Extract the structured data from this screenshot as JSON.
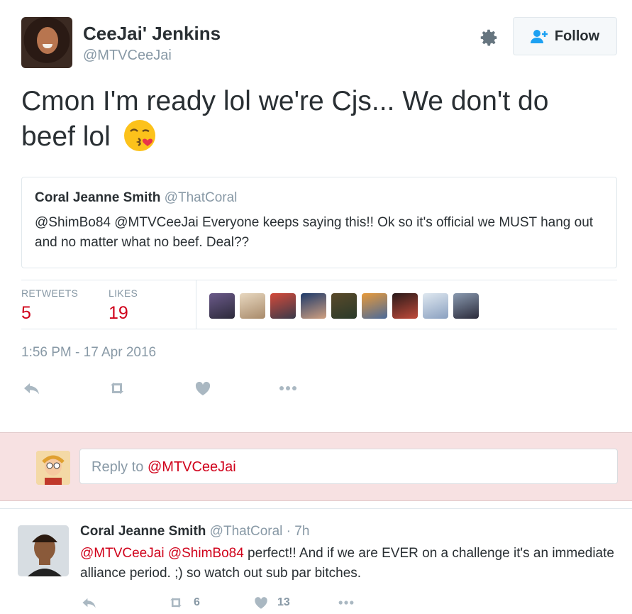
{
  "tweet": {
    "author_name": "CeeJai' Jenkins",
    "author_handle": "@MTVCeeJai",
    "follow_label": "Follow",
    "text": "Cmon I'm ready lol we're Cjs... We don't do beef lol",
    "emoji": "kissing-face-with-heart-emoji",
    "quote": {
      "name": "Coral Jeanne Smith",
      "handle": "@ThatCoral",
      "text": "@ShimBo84 @MTVCeeJai Everyone keeps saying this!! Ok so it's official we MUST hang out and no matter what no beef. Deal??"
    },
    "stats": {
      "retweets_label": "RETWEETS",
      "retweets": "5",
      "likes_label": "LIKES",
      "likes": "19"
    },
    "timestamp": "1:56 PM - 17 Apr 2016"
  },
  "reply_box": {
    "prefix": "Reply to ",
    "mention": "@MTVCeeJai"
  },
  "reply": {
    "name": "Coral Jeanne Smith",
    "handle": "@ThatCoral",
    "age": " · 7h",
    "mention1": "@MTVCeeJai",
    "mention2": "@ShimBo84",
    "text": " perfect!! And if we are EVER on a challenge it's an immediate alliance period. ;) so watch out sub par bitches.",
    "retweets": "6",
    "likes": "13"
  },
  "colors": {
    "accent": "#d0021b",
    "muted": "#8899a6",
    "reply_bar_bg": "#f7e1e2"
  },
  "icons": [
    "gear-icon",
    "follow-user-icon",
    "reply-icon",
    "retweet-icon",
    "like-icon",
    "more-icon"
  ]
}
